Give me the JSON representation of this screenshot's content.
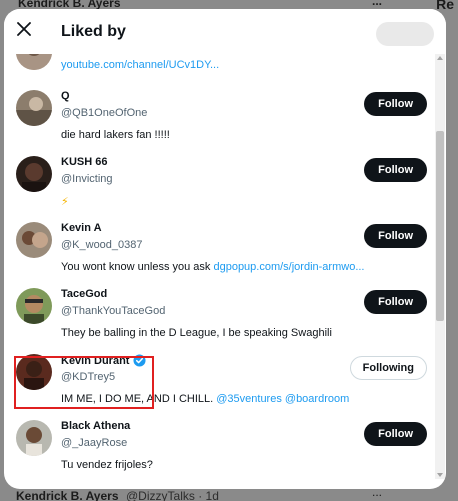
{
  "background": {
    "top_name": "Kendrick B. Ayers",
    "top_right": "Re",
    "top_menu": "...",
    "bottom_name": "Kendrick B. Ayers",
    "bottom_meta": "@DizzyTalks · 1d",
    "bottom_menu": "..."
  },
  "modal": {
    "title": "Liked by",
    "close_icon": "close-icon"
  },
  "partial_user": {
    "handle": "@...",
    "bio": "youtube.com/channel/UCv1DY..."
  },
  "users": [
    {
      "name": "Q",
      "handle": "@QB1OneOfOne",
      "bio": "die hard lakers fan !!!!!",
      "bio_link": "",
      "button": "Follow",
      "following": false
    },
    {
      "name": "KUSH 66",
      "handle": "@Invicting",
      "bio": "⚡",
      "bio_link": "",
      "button": "Follow",
      "following": false
    },
    {
      "name": "Kevin A",
      "handle": "@K_wood_0387",
      "bio": "You wont know unless you ask ",
      "bio_link": "dgpopup.com/s/jordin-armwo...",
      "button": "Follow",
      "following": false
    },
    {
      "name": "TaceGod",
      "handle": "@ThankYouTaceGod",
      "bio": "They be balling in the D League, I be speaking Swaghili",
      "bio_link": "",
      "button": "Follow",
      "following": false
    },
    {
      "name": "Kevin Durant",
      "handle": "@KDTrey5",
      "bio": "IM ME, I DO ME, AND I CHILL. ",
      "bio_link": "@35ventures @boardroom",
      "button": "Following",
      "following": true,
      "verified": true
    },
    {
      "name": "Black Athena",
      "handle": "@_JaayRose",
      "bio": "Tu vendez frijoles?",
      "bio_link": "",
      "button": "Follow",
      "following": false
    }
  ],
  "colors": {
    "accent_blue": "#1d9bf0",
    "button_dark": "#0f1419",
    "highlight_red": "#e02020"
  }
}
